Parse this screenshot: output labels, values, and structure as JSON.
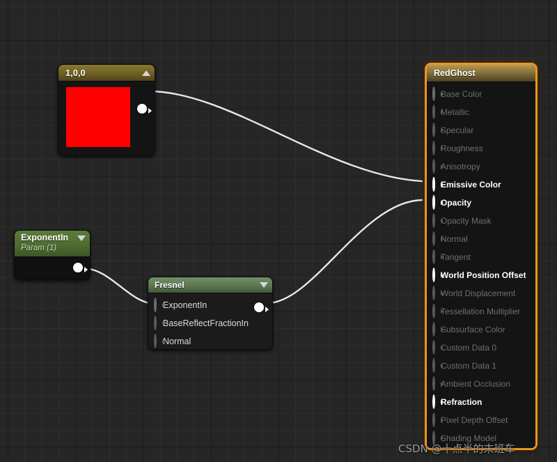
{
  "editor": {
    "name": "unreal-material-graph",
    "background_color": "#262626",
    "grid_minor_color": "#2f2f2f",
    "grid_major_color": "#1a1a1a"
  },
  "watermark": {
    "text": "CSDN @十点半的末班车"
  },
  "nodes": {
    "constant": {
      "title": "1,0,0",
      "swatch_color": "#ff0000",
      "collapse_icon": "triangle-up-icon",
      "header_color": "#6d5f23"
    },
    "exponent_param": {
      "title": "ExponentIn",
      "subtitle": "Param (1)",
      "collapse_icon": "triangle-down-icon",
      "header_color": "#4c6b30"
    },
    "fresnel": {
      "title": "Fresnel",
      "collapse_icon": "triangle-down-icon",
      "header_color": "#5b7752",
      "inputs": [
        {
          "label": "ExponentIn",
          "connected": true
        },
        {
          "label": "BaseReflectFractionIn",
          "connected": false
        },
        {
          "label": "Normal",
          "connected": false
        }
      ]
    },
    "result": {
      "title": "RedGhost",
      "selected": true,
      "selection_color": "#f0941e",
      "header_color": "#9c8345",
      "inputs": [
        {
          "label": "Base Color",
          "state": "filled-dim"
        },
        {
          "label": "Metallic",
          "state": "hollow-dim"
        },
        {
          "label": "Specular",
          "state": "hollow-dim"
        },
        {
          "label": "Roughness",
          "state": "hollow-dim"
        },
        {
          "label": "Anisotropy",
          "state": "hollow-dim"
        },
        {
          "label": "Emissive Color",
          "state": "filled-bright"
        },
        {
          "label": "Opacity",
          "state": "filled-bright"
        },
        {
          "label": "Opacity Mask",
          "state": "hollow-dim"
        },
        {
          "label": "Normal",
          "state": "hollow-dim"
        },
        {
          "label": "Tangent",
          "state": "hollow-dim"
        },
        {
          "label": "World Position Offset",
          "state": "hollow-bright"
        },
        {
          "label": "World Displacement",
          "state": "hollow-dim"
        },
        {
          "label": "Tessellation Multiplier",
          "state": "hollow-dim"
        },
        {
          "label": "Subsurface Color",
          "state": "hollow-dim"
        },
        {
          "label": "Custom Data 0",
          "state": "hollow-dim"
        },
        {
          "label": "Custom Data 1",
          "state": "hollow-dim"
        },
        {
          "label": "Ambient Occlusion",
          "state": "hollow-dim"
        },
        {
          "label": "Refraction",
          "state": "hollow-bright"
        },
        {
          "label": "Pixel Depth Offset",
          "state": "hollow-dim"
        },
        {
          "label": "Shading Model",
          "state": "hollow-dim"
        }
      ]
    }
  },
  "connections": [
    {
      "from": "constant.output",
      "to": "result.Emissive Color",
      "color": "#e8e8e8"
    },
    {
      "from": "exponent_param.output",
      "to": "fresnel.ExponentIn",
      "color": "#e8e8e8"
    },
    {
      "from": "fresnel.output",
      "to": "result.Opacity",
      "color": "#e8e8e8"
    }
  ]
}
